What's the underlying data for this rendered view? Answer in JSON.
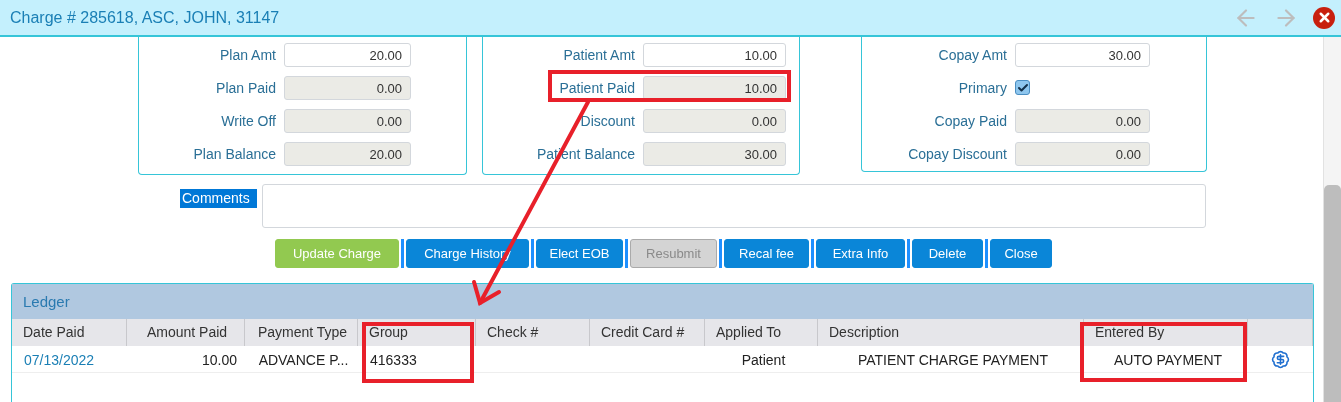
{
  "window": {
    "title": "Charge # 285618, ASC, JOHN, 31147"
  },
  "panels": [
    {
      "fields": [
        {
          "label": "Plan Amt",
          "kind": "input",
          "value": "20.00"
        },
        {
          "label": "Plan Paid",
          "kind": "readonly",
          "value": "0.00"
        },
        {
          "label": "Write Off",
          "kind": "readonly",
          "value": "0.00"
        },
        {
          "label": "Plan Balance",
          "kind": "readonly",
          "value": "20.00"
        }
      ]
    },
    {
      "fields": [
        {
          "label": "Patient Amt",
          "kind": "input",
          "value": "10.00"
        },
        {
          "label": "Patient Paid",
          "kind": "readonly",
          "value": "10.00"
        },
        {
          "label": "Discount",
          "kind": "readonly",
          "value": "0.00"
        },
        {
          "label": "Patient Balance",
          "kind": "readonly",
          "value": "30.00"
        }
      ]
    },
    {
      "fields": [
        {
          "label": "Copay Amt",
          "kind": "input",
          "value": "30.00"
        },
        {
          "label": "Primary",
          "kind": "checkbox",
          "checked": true
        },
        {
          "label": "Copay Paid",
          "kind": "readonly",
          "value": "0.00"
        },
        {
          "label": "Copay Discount",
          "kind": "readonly",
          "value": "0.00"
        }
      ]
    }
  ],
  "comments": {
    "label": "Comments",
    "highlighted": true
  },
  "buttons": [
    {
      "label": "Update Charge",
      "kind": "success"
    },
    {
      "label": "Charge History",
      "kind": "primary"
    },
    {
      "label": "Elect EOB",
      "kind": "primary"
    },
    {
      "label": "Resubmit",
      "kind": "disabled"
    },
    {
      "label": "Recal fee",
      "kind": "primary"
    },
    {
      "label": "Extra Info",
      "kind": "primary"
    },
    {
      "label": "Delete",
      "kind": "primary"
    },
    {
      "label": "Close",
      "kind": "primary"
    }
  ],
  "ledger": {
    "title": "Ledger",
    "columns": [
      "Date Paid",
      "Amount Paid",
      "Payment Type",
      "Group",
      "Check #",
      "Credit Card #",
      "Applied To",
      "Description",
      "Entered By"
    ],
    "rows": [
      {
        "cells": [
          "07/13/2022",
          "10.00",
          "ADVANCE P...",
          "416333",
          "",
          "",
          "Patient",
          "PATIENT CHARGE PAYMENT",
          "AUTO PAYMENT"
        ]
      }
    ]
  }
}
